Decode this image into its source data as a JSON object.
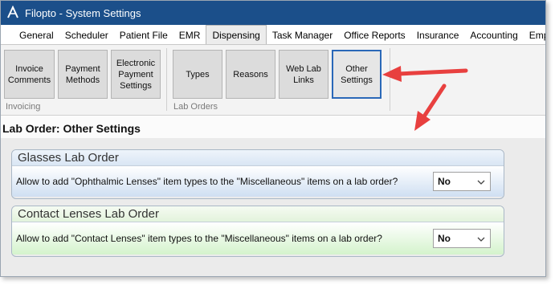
{
  "window": {
    "title": "Filopto - System Settings"
  },
  "menu": {
    "tabs": [
      {
        "label": "General"
      },
      {
        "label": "Scheduler"
      },
      {
        "label": "Patient File"
      },
      {
        "label": "EMR"
      },
      {
        "label": "Dispensing"
      },
      {
        "label": "Task Manager"
      },
      {
        "label": "Office Reports"
      },
      {
        "label": "Insurance"
      },
      {
        "label": "Accounting"
      },
      {
        "label": "Emplo"
      }
    ],
    "active": "Dispensing"
  },
  "ribbon": {
    "invoicing": {
      "group_label": "Invoicing",
      "buttons": [
        {
          "label": "Invoice\nComments"
        },
        {
          "label": "Payment\nMethods"
        },
        {
          "label": "Electronic\nPayment\nSettings"
        }
      ]
    },
    "lab_orders": {
      "group_label": "Lab Orders",
      "buttons": [
        {
          "label": "Types"
        },
        {
          "label": "Reasons"
        },
        {
          "label": "Web Lab\nLinks"
        },
        {
          "label": "Other\nSettings"
        }
      ]
    },
    "selected": "Other Settings"
  },
  "page": {
    "title": "Lab Order: Other Settings"
  },
  "panels": {
    "glasses": {
      "title": "Glasses Lab Order",
      "question": "Allow to add \"Ophthalmic Lenses\" item types to the \"Miscellaneous\" items on a lab order?",
      "value": "No"
    },
    "contacts": {
      "title": "Contact Lenses Lab Order",
      "question": "Allow to add \"Contact Lenses\" item types to the \"Miscellaneous\" items on a lab order?",
      "value": "No"
    }
  },
  "colors": {
    "titlebar": "#1b4f8a",
    "annotation_arrow": "#e8403f",
    "selected_border": "#2a68b8"
  },
  "icons": {
    "app": "filopto-logo-icon",
    "dropdown": "chevron-down-icon",
    "annotation": "red-arrow-icon"
  }
}
